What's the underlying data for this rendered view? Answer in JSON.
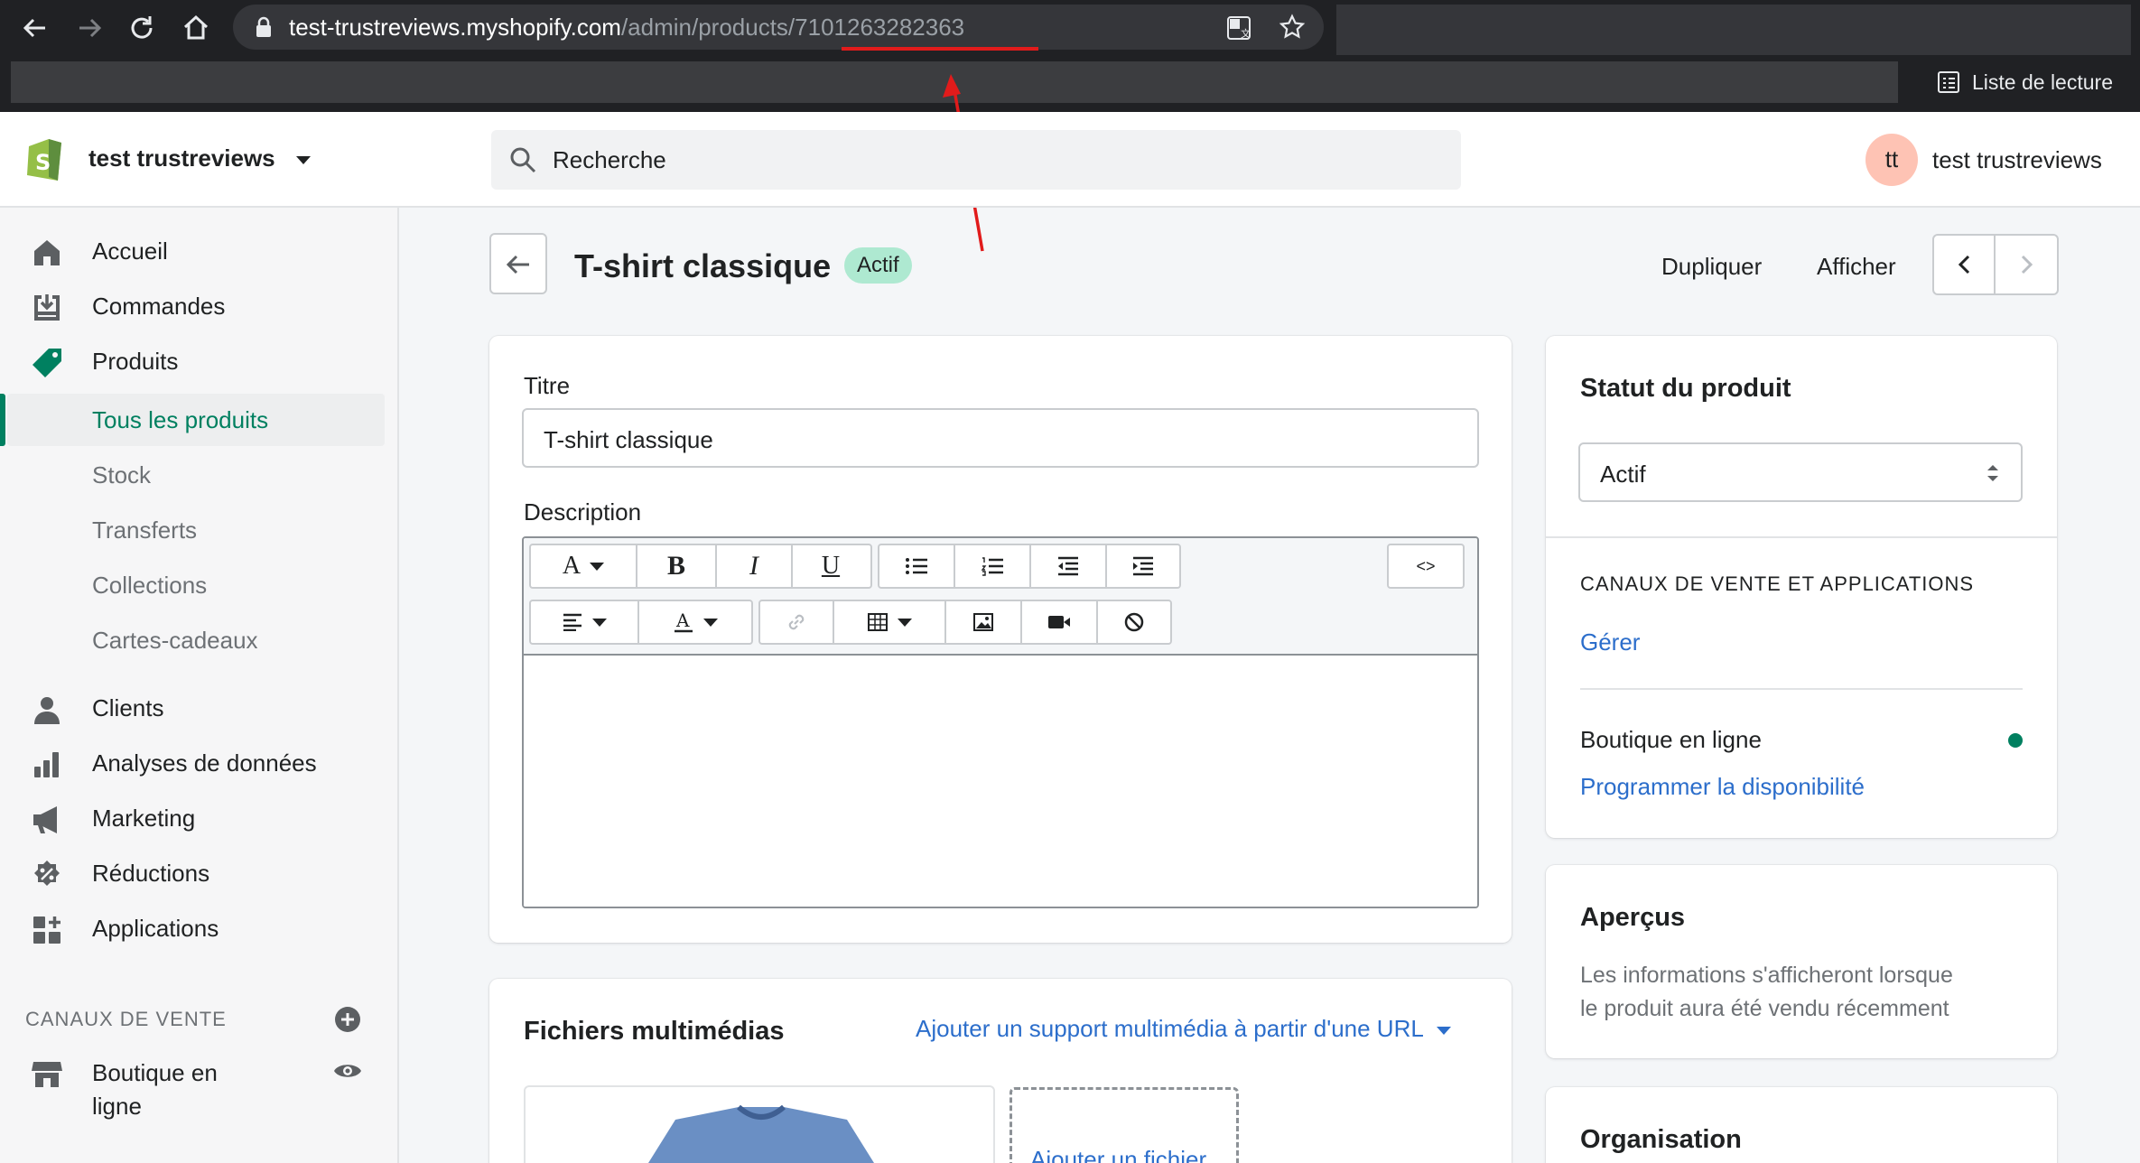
{
  "browser": {
    "url_host": "test-trustreviews.myshopify.com",
    "url_path": "/admin/products/",
    "url_id": "7101263282363",
    "reading_list": "Liste de lecture"
  },
  "topbar": {
    "store_name": "test trustreviews",
    "search_placeholder": "Recherche",
    "avatar_initials": "tt",
    "account_name": "test trustreviews"
  },
  "sidebar": {
    "items": [
      {
        "label": "Accueil",
        "icon": "home-icon"
      },
      {
        "label": "Commandes",
        "icon": "orders-icon"
      },
      {
        "label": "Produits",
        "icon": "tag-icon"
      },
      {
        "label": "Tous les produits"
      },
      {
        "label": "Stock"
      },
      {
        "label": "Transferts"
      },
      {
        "label": "Collections"
      },
      {
        "label": "Cartes-cadeaux"
      },
      {
        "label": "Clients",
        "icon": "customer-icon"
      },
      {
        "label": "Analyses de données",
        "icon": "analytics-icon"
      },
      {
        "label": "Marketing",
        "icon": "megaphone-icon"
      },
      {
        "label": "Réductions",
        "icon": "discount-icon"
      },
      {
        "label": "Applications",
        "icon": "apps-icon"
      }
    ],
    "channels_heading": "CANAUX DE VENTE",
    "channel_label": "Boutique en ligne"
  },
  "product": {
    "title": "T-shirt classique",
    "status_badge": "Actif",
    "duplicate_label": "Dupliquer",
    "view_label": "Afficher"
  },
  "form": {
    "title_label": "Titre",
    "title_value": "T-shirt classique",
    "description_label": "Description",
    "html_toggle": "<>"
  },
  "media": {
    "heading": "Fichiers multimédias",
    "add_url_link": "Ajouter un support multimédia à partir d'une URL",
    "add_file": "Ajouter un fichier"
  },
  "status_card": {
    "heading": "Statut du produit",
    "select_value": "Actif",
    "channels_heading": "CANAUX DE VENTE ET APPLICATIONS",
    "manage_link": "Gérer",
    "channel_name": "Boutique en ligne",
    "schedule_link": "Programmer la disponibilité"
  },
  "insights_card": {
    "heading": "Aperçus",
    "line1": "Les informations s'afficheront lorsque",
    "line2": "le produit aura été vendu récemment"
  },
  "organization_card": {
    "heading": "Organisation"
  },
  "colors": {
    "accent_green": "#008060",
    "link_blue": "#2c6ecb",
    "badge_green": "#aee9d1",
    "annotation_red": "#e11b1b"
  }
}
